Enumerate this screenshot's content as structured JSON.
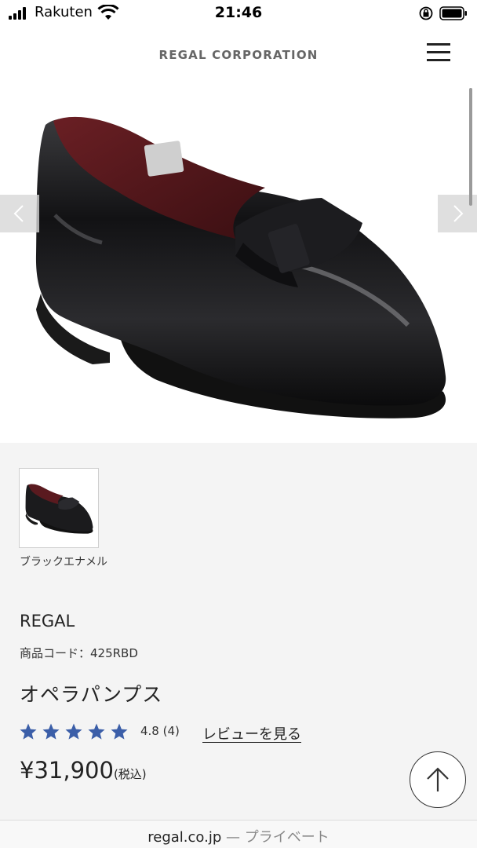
{
  "status_bar": {
    "carrier": "Rakuten",
    "time": "21:46"
  },
  "header": {
    "brand": "REGAL CORPORATION",
    "menu_icon": "hamburger-menu-icon"
  },
  "gallery": {
    "prev_icon": "chevron-left-icon",
    "next_icon": "chevron-right-icon"
  },
  "variants": [
    {
      "label": "ブラックエナメル"
    }
  ],
  "product": {
    "maker": "REGAL",
    "code": "商品コード：425RBD",
    "name": "オペラパンプス",
    "rating": {
      "stars_filled": 5,
      "stars_total": 5,
      "value": "4.8",
      "count": "(4)",
      "star_color": "#3b5ea8"
    },
    "review_link": "レビューを見る",
    "price": "¥31,900",
    "tax_note": "(税込)"
  },
  "scroll_top_icon": "arrow-up-icon",
  "url_bar": {
    "domain": "regal.co.jp",
    "separator": "—",
    "mode": "プライベート"
  }
}
